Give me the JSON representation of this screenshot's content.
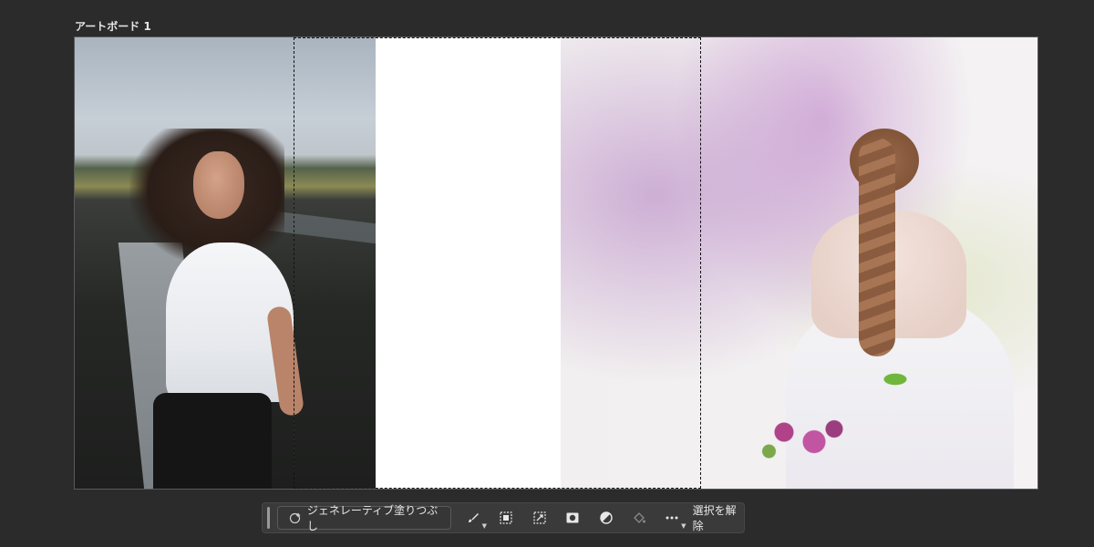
{
  "artboard": {
    "label": "アートボード 1"
  },
  "taskbar": {
    "generative_fill_label": "ジェネレーティブ塗りつぶし",
    "deselect_label": "選択を解除",
    "icons": [
      "sparkle-icon",
      "brush-icon",
      "select-subject-icon",
      "transform-selection-icon",
      "mask-icon",
      "adjustment-icon",
      "fill-icon",
      "more-icon"
    ]
  },
  "colors": {
    "canvas_bg": "#2b2b2b",
    "taskbar_bg": "#3a3a3a",
    "text": "#e8e8e8"
  }
}
